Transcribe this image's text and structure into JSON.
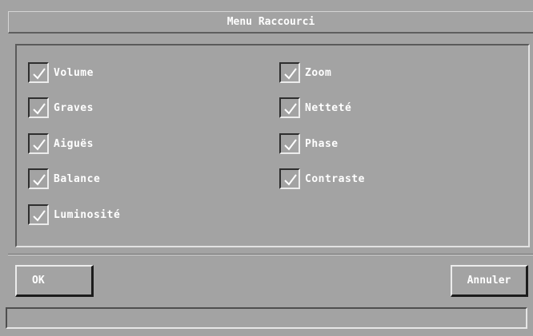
{
  "window": {
    "title": "Menu Raccourci"
  },
  "checkboxes": {
    "left": [
      {
        "label": "Volume",
        "checked": true
      },
      {
        "label": "Graves",
        "checked": true
      },
      {
        "label": "Aiguës",
        "checked": true
      },
      {
        "label": "Balance",
        "checked": true
      },
      {
        "label": "Luminosité",
        "checked": true
      }
    ],
    "right": [
      {
        "label": "Zoom",
        "checked": true
      },
      {
        "label": "Netteté",
        "checked": true
      },
      {
        "label": "Phase",
        "checked": true
      },
      {
        "label": "Contraste",
        "checked": true
      }
    ]
  },
  "buttons": {
    "ok_label": "OK",
    "cancel_label": "Annuler"
  },
  "status": {
    "text": ""
  },
  "colors": {
    "background": "#a3a3a3",
    "text": "#ffffff"
  }
}
